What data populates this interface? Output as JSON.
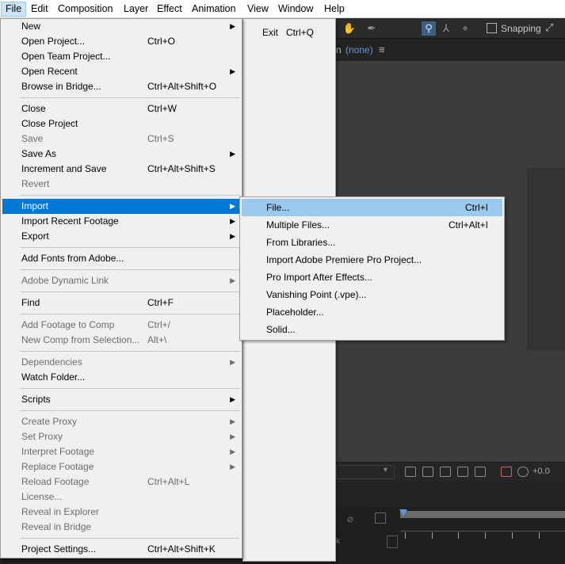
{
  "menubar": {
    "items": [
      "File",
      "Edit",
      "Composition",
      "Layer",
      "Effect",
      "Animation",
      "View",
      "Window",
      "Help"
    ]
  },
  "toolbar": {
    "snapping_label": "Snapping"
  },
  "composition_panel": {
    "suffix": "n",
    "value": "(none)"
  },
  "viewer_bar": {
    "exposure": "+0.0"
  },
  "timeline": {
    "k_label": "k"
  },
  "file_menu": {
    "items": [
      {
        "label": "New",
        "shortcut": "",
        "submenu": true,
        "disabled": false
      },
      {
        "label": "Open Project...",
        "shortcut": "Ctrl+O",
        "submenu": false,
        "disabled": false
      },
      {
        "label": "Open Team Project...",
        "shortcut": "",
        "submenu": false,
        "disabled": false
      },
      {
        "label": "Open Recent",
        "shortcut": "",
        "submenu": true,
        "disabled": false
      },
      {
        "label": "Browse in Bridge...",
        "shortcut": "Ctrl+Alt+Shift+O",
        "submenu": false,
        "disabled": false
      },
      {
        "label": "Close",
        "shortcut": "Ctrl+W",
        "submenu": false,
        "disabled": false
      },
      {
        "label": "Close Project",
        "shortcut": "",
        "submenu": false,
        "disabled": false
      },
      {
        "label": "Save",
        "shortcut": "Ctrl+S",
        "submenu": false,
        "disabled": true
      },
      {
        "label": "Save As",
        "shortcut": "",
        "submenu": true,
        "disabled": false
      },
      {
        "label": "Increment and Save",
        "shortcut": "Ctrl+Alt+Shift+S",
        "submenu": false,
        "disabled": false
      },
      {
        "label": "Revert",
        "shortcut": "",
        "submenu": false,
        "disabled": true
      },
      {
        "label": "Import",
        "shortcut": "",
        "submenu": true,
        "disabled": false,
        "highlighted": true
      },
      {
        "label": "Import Recent Footage",
        "shortcut": "",
        "submenu": true,
        "disabled": false
      },
      {
        "label": "Export",
        "shortcut": "",
        "submenu": true,
        "disabled": false
      },
      {
        "label": "Add Fonts from Adobe...",
        "shortcut": "",
        "submenu": false,
        "disabled": false
      },
      {
        "label": "Adobe Dynamic Link",
        "shortcut": "",
        "submenu": true,
        "disabled": true
      },
      {
        "label": "Find",
        "shortcut": "Ctrl+F",
        "submenu": false,
        "disabled": false
      },
      {
        "label": "Add Footage to Comp",
        "shortcut": "Ctrl+/",
        "submenu": false,
        "disabled": true
      },
      {
        "label": "New Comp from Selection...",
        "shortcut": "Alt+\\",
        "submenu": false,
        "disabled": true
      },
      {
        "label": "Dependencies",
        "shortcut": "",
        "submenu": true,
        "disabled": true
      },
      {
        "label": "Watch Folder...",
        "shortcut": "",
        "submenu": false,
        "disabled": false
      },
      {
        "label": "Scripts",
        "shortcut": "",
        "submenu": true,
        "disabled": false
      },
      {
        "label": "Create Proxy",
        "shortcut": "",
        "submenu": true,
        "disabled": true
      },
      {
        "label": "Set Proxy",
        "shortcut": "",
        "submenu": true,
        "disabled": true
      },
      {
        "label": "Interpret Footage",
        "shortcut": "",
        "submenu": true,
        "disabled": true
      },
      {
        "label": "Replace Footage",
        "shortcut": "",
        "submenu": true,
        "disabled": true
      },
      {
        "label": "Reload Footage",
        "shortcut": "Ctrl+Alt+L",
        "submenu": false,
        "disabled": true
      },
      {
        "label": "License...",
        "shortcut": "",
        "submenu": false,
        "disabled": true
      },
      {
        "label": "Reveal in Explorer",
        "shortcut": "",
        "submenu": false,
        "disabled": true
      },
      {
        "label": "Reveal in Bridge",
        "shortcut": "",
        "submenu": false,
        "disabled": true
      },
      {
        "label": "Project Settings...",
        "shortcut": "Ctrl+Alt+Shift+K",
        "submenu": false,
        "disabled": false
      }
    ]
  },
  "edit_menu": {
    "items": [
      {
        "label": "Exit",
        "shortcut": "Ctrl+Q"
      }
    ]
  },
  "import_submenu": {
    "items": [
      {
        "label": "File...",
        "shortcut": "Ctrl+I",
        "highlighted": true
      },
      {
        "label": "Multiple Files...",
        "shortcut": "Ctrl+Alt+I"
      },
      {
        "label": "From Libraries...",
        "shortcut": ""
      },
      {
        "label": "Import Adobe Premiere Pro Project...",
        "shortcut": ""
      },
      {
        "label": "Pro Import After Effects...",
        "shortcut": ""
      },
      {
        "label": "Vanishing Point (.vpe)...",
        "shortcut": ""
      },
      {
        "label": "Placeholder...",
        "shortcut": ""
      },
      {
        "label": "Solid...",
        "shortcut": ""
      }
    ]
  },
  "colors": {
    "highlight": "#0078d7",
    "sub_highlight": "#99c9ef",
    "menubar_active": "#cce4f7",
    "app_bg": "#3c3c3c"
  }
}
